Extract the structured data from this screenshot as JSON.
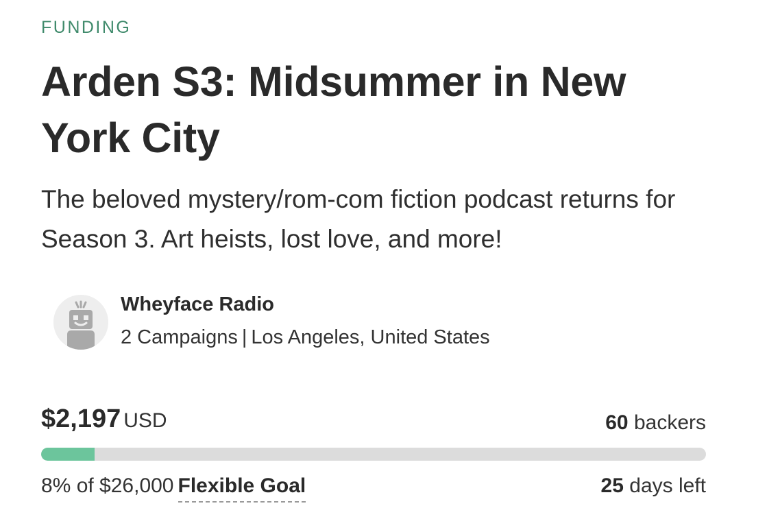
{
  "category": "FUNDING",
  "campaign": {
    "title": "Arden S3: Midsummer in New York City",
    "blurb": "The beloved mystery/rom-com fiction podcast returns for Season 3. Art heists, lost love, and more!"
  },
  "creator": {
    "name": "Wheyface Radio",
    "campaigns": "2 Campaigns",
    "separator": "|",
    "location": "Los Angeles, United States",
    "avatar_icon": "robot-avatar-icon"
  },
  "funding": {
    "amount": "$2,197",
    "currency": "USD",
    "backers_count": "60",
    "backers_label": "backers",
    "percent_text": "8% of $26,000",
    "goal_type": "Flexible Goal",
    "days_count": "25",
    "days_label": "days left",
    "progress_percent": 8
  },
  "colors": {
    "accent": "#3f8a6b",
    "progress_fill": "#6cc59c",
    "progress_track": "#dcdcdc"
  }
}
